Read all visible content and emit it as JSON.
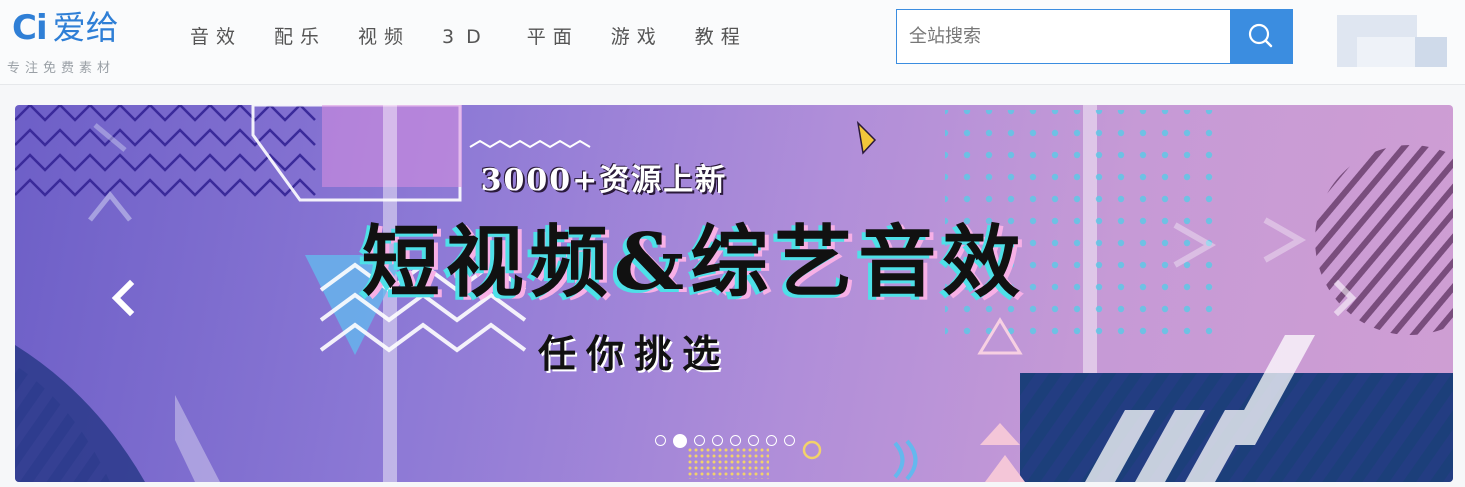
{
  "logo": {
    "mark": "Ci",
    "name": "爱给",
    "tagline": "专注免费素材"
  },
  "nav": {
    "items": [
      "音效",
      "配乐",
      "视频",
      "3D",
      "平面",
      "游戏",
      "教程"
    ]
  },
  "search": {
    "placeholder": "全站搜索",
    "value": ""
  },
  "banner": {
    "top_text": "3000+资源上新",
    "main_text": "短视频&综艺音效",
    "sub_text": "任你挑选",
    "slide_count": 8,
    "active_slide": 2
  },
  "icons": {
    "search": "search-icon",
    "prev": "chevron-left-icon",
    "next": "chevron-right-icon"
  },
  "colors": {
    "brand": "#2f7fd6",
    "search_button": "#3b8de0"
  }
}
